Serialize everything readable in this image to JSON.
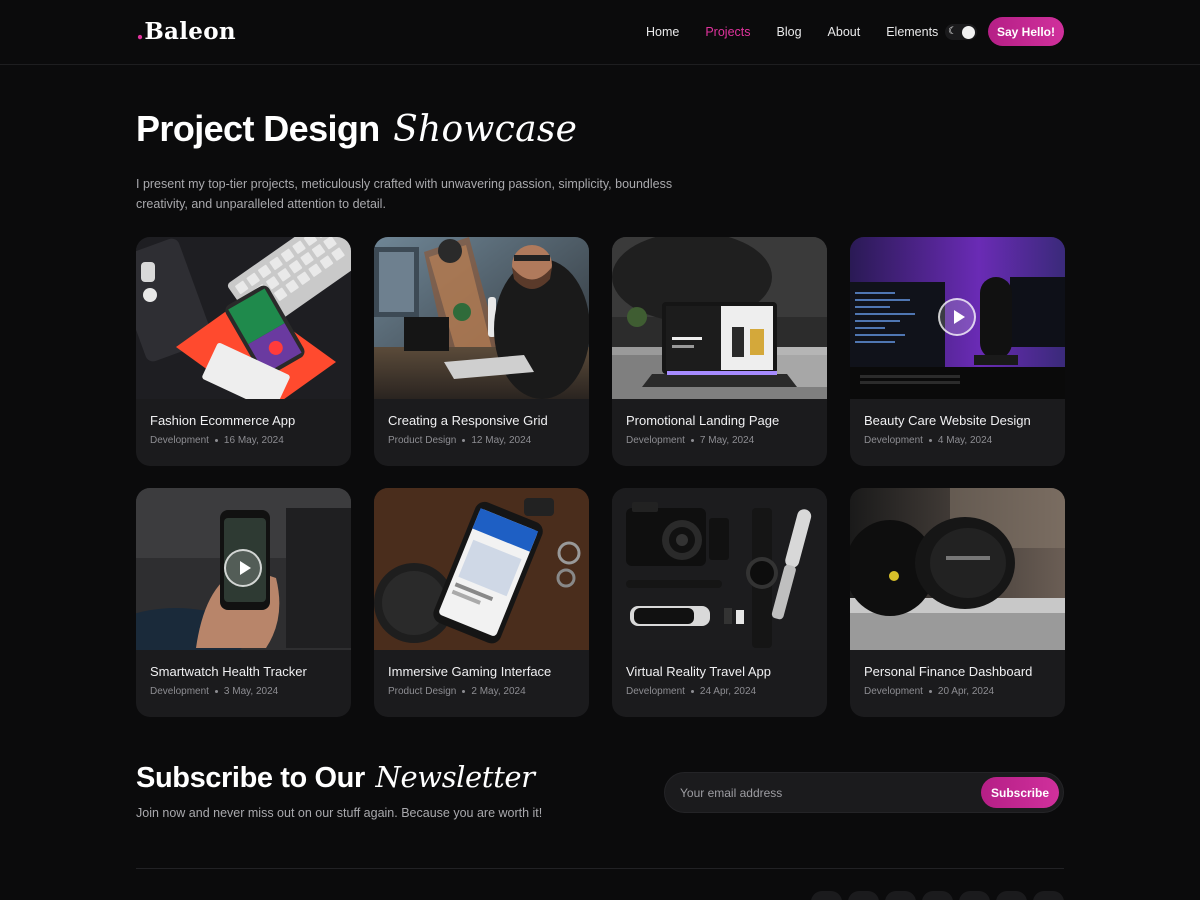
{
  "header": {
    "logo_dot": ".",
    "logo_text": "Baleon",
    "nav": [
      {
        "label": "Home",
        "active": false
      },
      {
        "label": "Projects",
        "active": true
      },
      {
        "label": "Blog",
        "active": false
      },
      {
        "label": "About",
        "active": false
      },
      {
        "label": "Elements",
        "active": false
      }
    ],
    "cta_label": "Say Hello!",
    "toggle_icon": "moon-icon"
  },
  "hero": {
    "title": "Project Design",
    "title_accent": "Showcase",
    "description": "I present my top-tier projects, meticulously crafted with unwavering passion, simplicity, boundless creativity, and unparalleled attention to detail."
  },
  "projects": [
    {
      "title": "Fashion Ecommerce App",
      "category": "Development",
      "date": "16 May, 2024"
    },
    {
      "title": "Creating a Responsive Grid",
      "category": "Product Design",
      "date": "12 May, 2024"
    },
    {
      "title": "Promotional Landing Page",
      "category": "Development",
      "date": "7 May, 2024"
    },
    {
      "title": "Beauty Care Website Design",
      "category": "Development",
      "date": "4 May, 2024"
    },
    {
      "title": "Smartwatch Health Tracker",
      "category": "Development",
      "date": "3 May, 2024"
    },
    {
      "title": "Immersive Gaming Interface",
      "category": "Product Design",
      "date": "2 May, 2024"
    },
    {
      "title": "Virtual Reality Travel App",
      "category": "Development",
      "date": "24 Apr, 2024"
    },
    {
      "title": "Personal Finance Dashboard",
      "category": "Development",
      "date": "20 Apr, 2024"
    }
  ],
  "newsletter": {
    "title": "Subscribe to Our",
    "title_accent": "Newsletter",
    "description": "Join now and never miss out on our stuff again. Because you are worth it!",
    "input_placeholder": "Your email address",
    "button_label": "Subscribe"
  },
  "colors": {
    "accent": "#d0309c",
    "background": "#0b0b0c",
    "card": "#1b1b1d"
  }
}
